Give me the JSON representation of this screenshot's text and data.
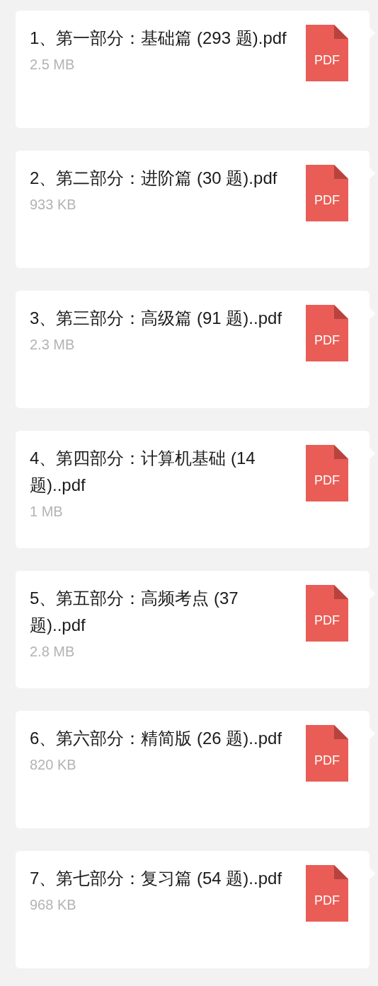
{
  "files": [
    {
      "name": "1、第一部分：基础篇 (293 题).pdf",
      "size": "2.5 MB",
      "type": "PDF"
    },
    {
      "name": "2、第二部分：进阶篇 (30 题).pdf",
      "size": "933 KB",
      "type": "PDF"
    },
    {
      "name": "3、第三部分：高级篇 (91 题)..pdf",
      "size": "2.3 MB",
      "type": "PDF"
    },
    {
      "name": "4、第四部分：计算机基础 (14 题)..pdf",
      "size": "1 MB",
      "type": "PDF"
    },
    {
      "name": "5、第五部分：高频考点 (37 题)..pdf",
      "size": "2.8 MB",
      "type": "PDF"
    },
    {
      "name": "6、第六部分：精简版 (26 题)..pdf",
      "size": "820 KB",
      "type": "PDF"
    },
    {
      "name": "7、第七部分：复习篇 (54 题)..pdf",
      "size": "968 KB",
      "type": "PDF"
    }
  ]
}
